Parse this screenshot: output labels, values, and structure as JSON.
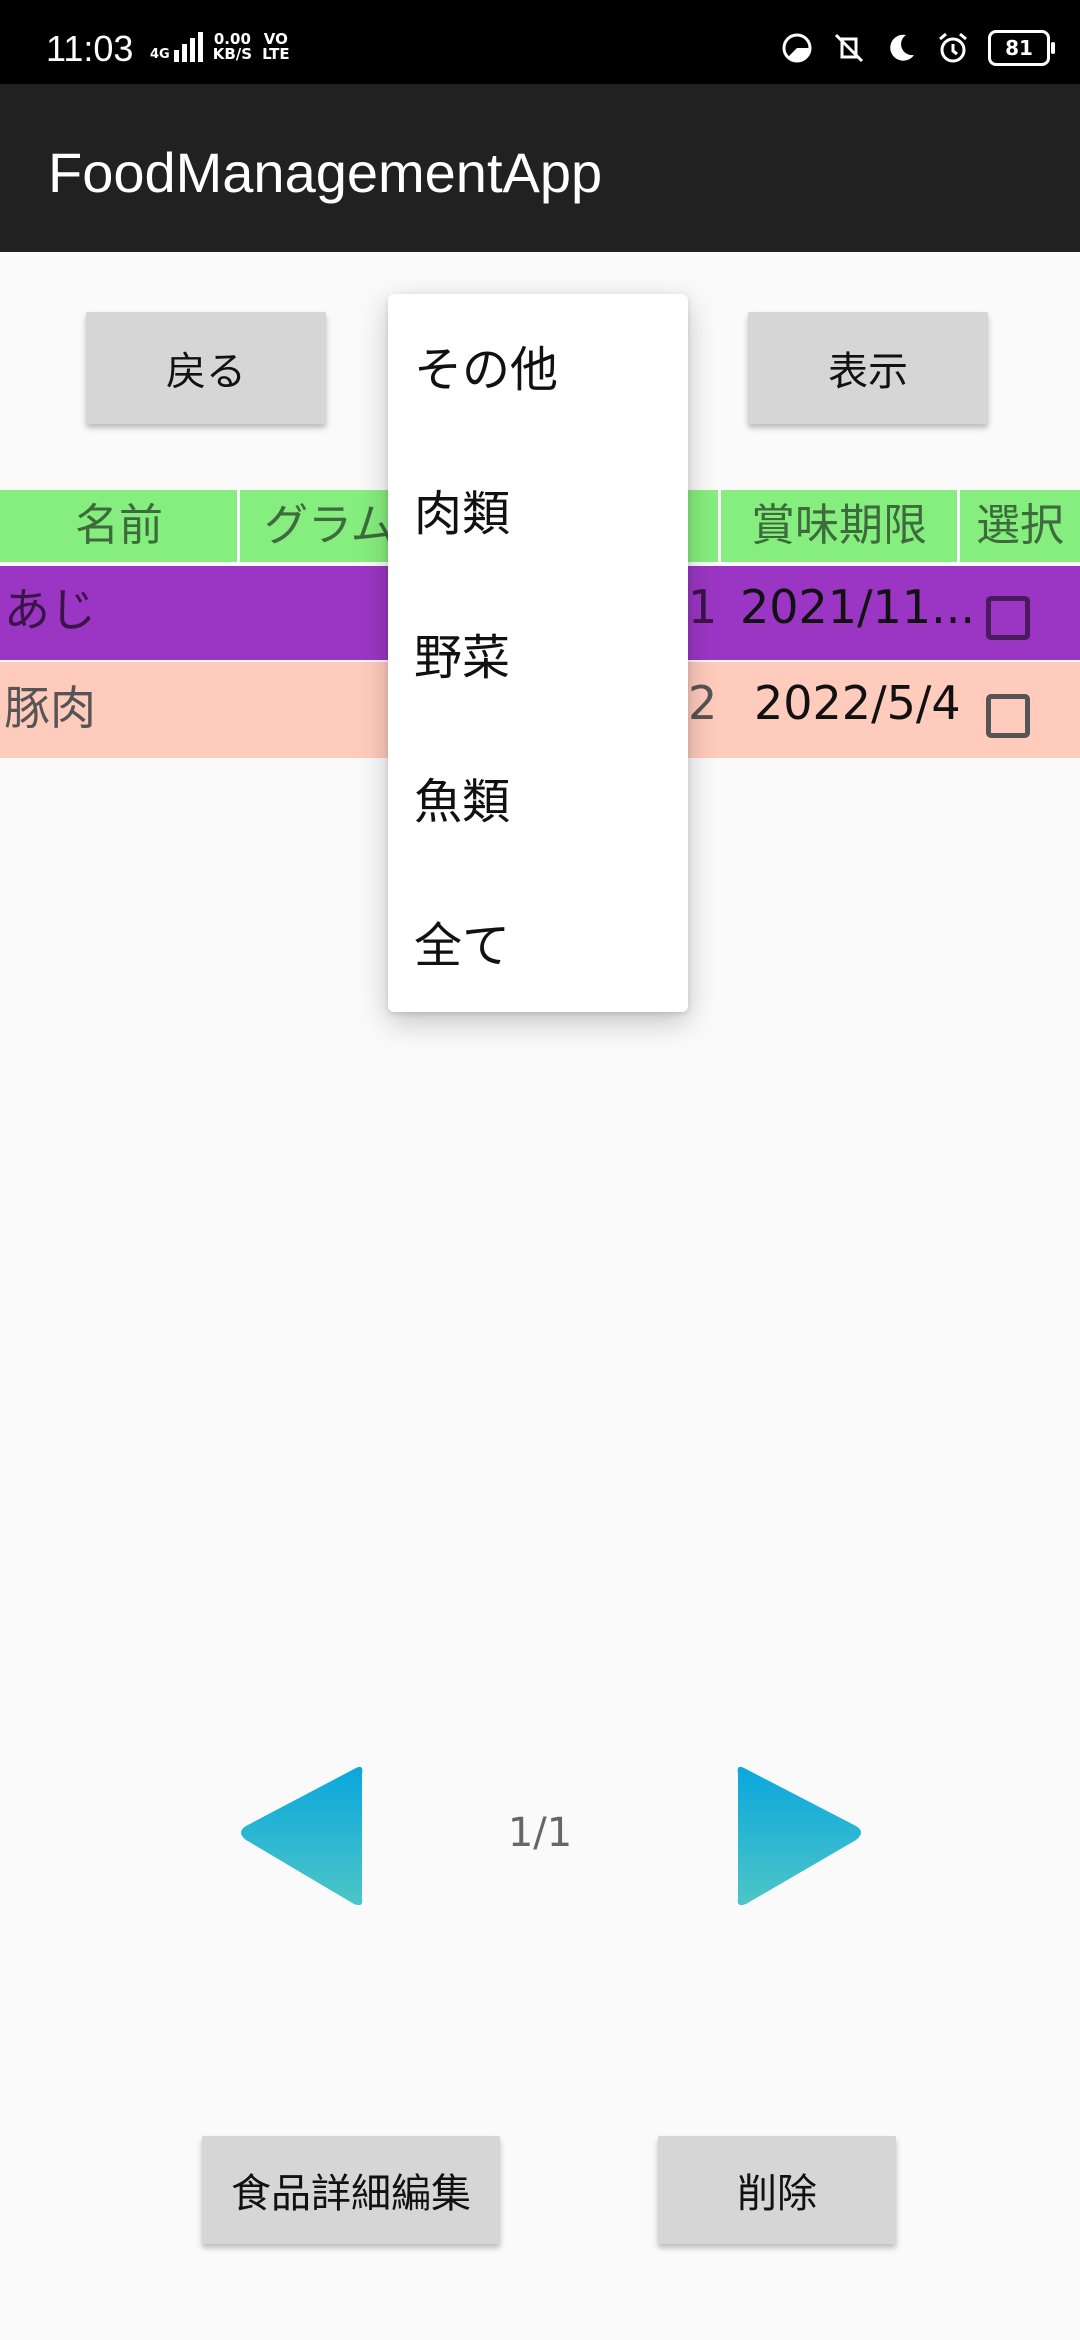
{
  "status_bar": {
    "time": "11:03",
    "network": "4G",
    "speed_value": "0.00",
    "speed_unit": "KB/S",
    "volte_top": "VO",
    "volte_bottom": "LTE",
    "battery": "81",
    "icons": [
      "data-saver-icon",
      "vibrate-off-icon",
      "moon-icon",
      "alarm-icon",
      "battery-icon"
    ]
  },
  "app": {
    "title": "FoodManagementApp"
  },
  "toolbar": {
    "back_label": "戻る",
    "show_label": "表示"
  },
  "table": {
    "headers": [
      "名前",
      "グラム",
      "賞味期限",
      "選択"
    ],
    "rows": [
      {
        "name": "あじ",
        "number": "1",
        "expiry": "2021/11...",
        "color": "#9b36c4",
        "checked": false
      },
      {
        "name": "豚肉",
        "number": "2",
        "expiry": "2022/5/4",
        "color": "#ffcbbd",
        "checked": false
      }
    ]
  },
  "dropdown": {
    "options": [
      "その他",
      "肉類",
      "野菜",
      "魚類",
      "全て"
    ]
  },
  "pager": {
    "page": "1/1",
    "accent_top": "#0aa7de",
    "accent_bottom": "#4dc6c6"
  },
  "bottom": {
    "edit_label": "食品詳細編集",
    "delete_label": "削除"
  }
}
